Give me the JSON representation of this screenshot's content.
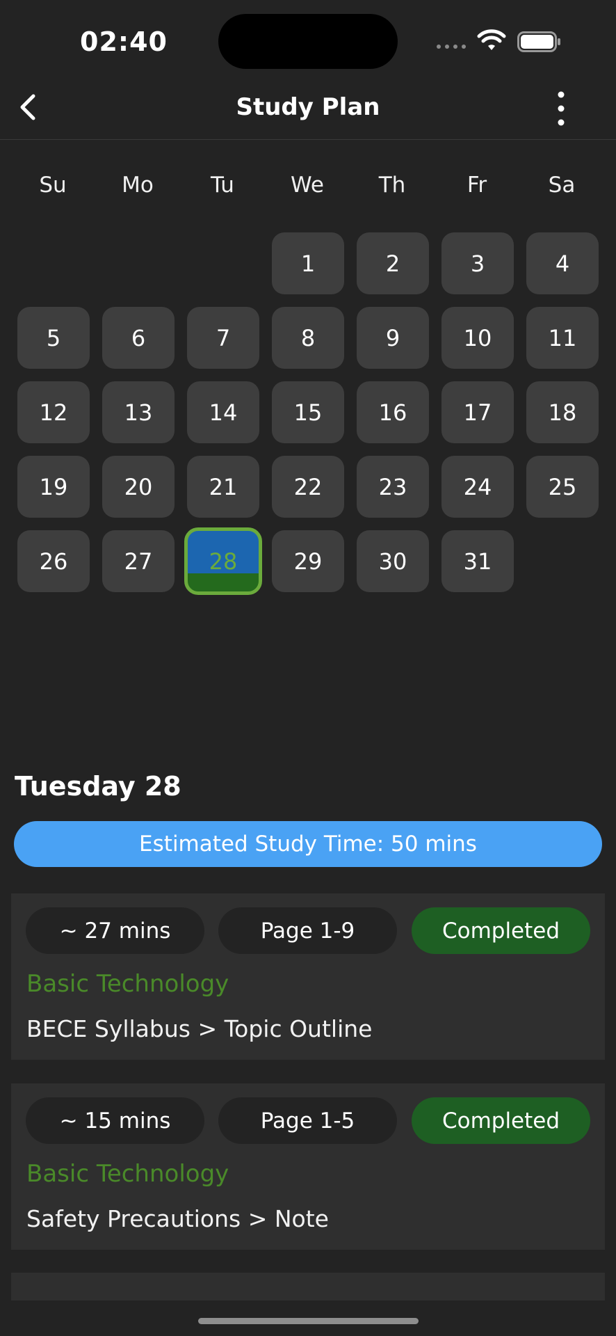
{
  "status_bar": {
    "time": "02:40"
  },
  "header": {
    "title": "Study Plan"
  },
  "calendar": {
    "weekdays": [
      "Su",
      "Mo",
      "Tu",
      "We",
      "Th",
      "Fr",
      "Sa"
    ],
    "selected_day": "28"
  },
  "day_detail": {
    "heading": "Tuesday 28",
    "estimate": "Estimated Study Time: 50 mins",
    "tasks": [
      {
        "duration": "~ 27 mins",
        "pages": "Page 1-9",
        "status": "Completed",
        "subject": "Basic Technology",
        "path": "BECE Syllabus > Topic Outline"
      },
      {
        "duration": "~ 15 mins",
        "pages": "Page 1-5",
        "status": "Completed",
        "subject": "Basic Technology",
        "path": "Safety Precautions > Note"
      }
    ]
  },
  "colors": {
    "accent_blue": "#4aa2f4",
    "subject_green": "#4a8a29",
    "completed_green": "#1e5f23",
    "selected_border": "#6bab3c"
  }
}
